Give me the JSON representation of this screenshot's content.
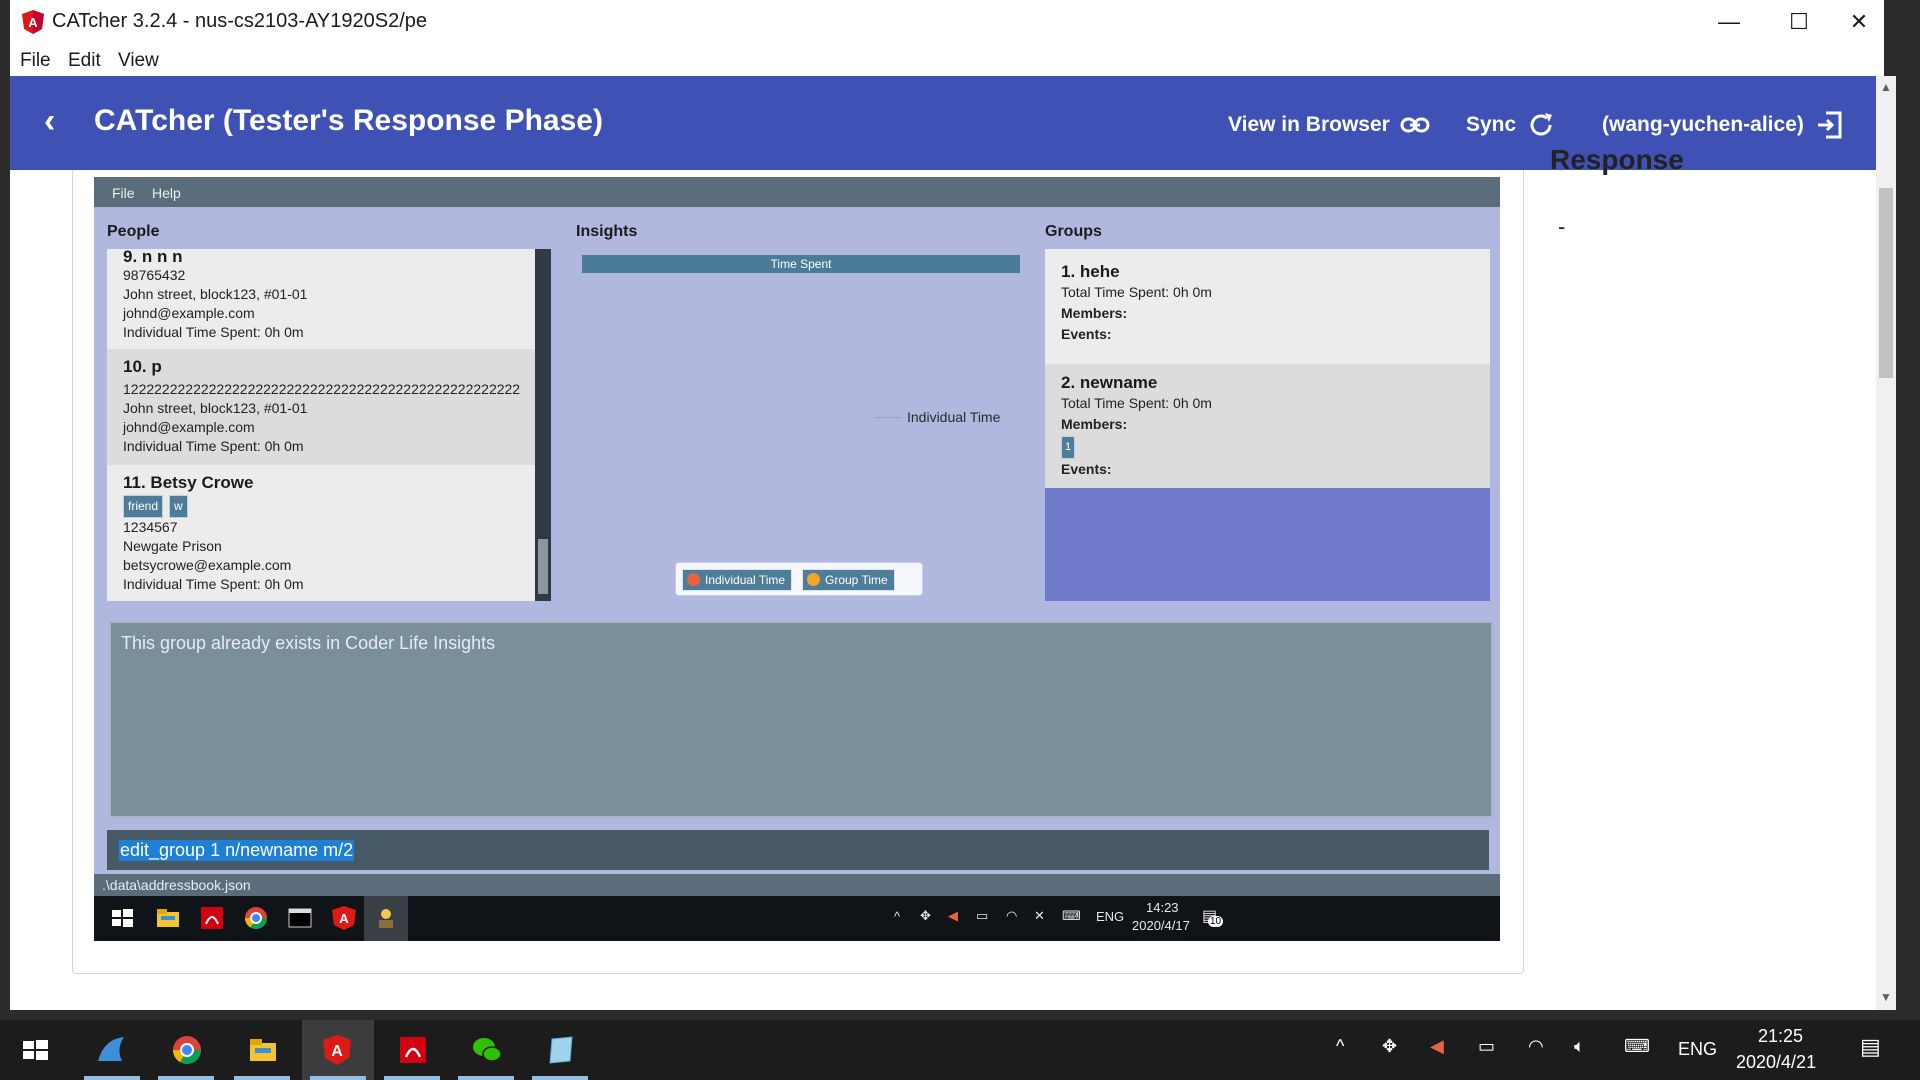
{
  "window": {
    "title": "CATcher 3.2.4 - nus-cs2103-AY1920S2/pe",
    "menu": [
      "File",
      "Edit",
      "View"
    ]
  },
  "header": {
    "title": "CATcher  (Tester's Response Phase)",
    "view_in_browser": "View in Browser",
    "sync": "Sync",
    "user": "(wang-yuchen-alice)"
  },
  "response": {
    "value": "-"
  },
  "app": {
    "menu": [
      "File",
      "Help"
    ],
    "people_title": "People",
    "insights_title": "Insights",
    "groups_title": "Groups",
    "people": [
      {
        "name": "9.  n n n",
        "tags": [],
        "lines": [
          "98765432",
          "John street, block123, #01-01",
          "johnd@example.com",
          "Individual Time Spent: 0h 0m"
        ]
      },
      {
        "name": "10.  p",
        "tags": [],
        "lines": [
          "122222222222222222222222222222222222222222222222222",
          "John street, block123, #01-01",
          "johnd@example.com",
          "Individual Time Spent: 0h 0m"
        ]
      },
      {
        "name": "11.  Betsy Crowe",
        "tags": [
          "friend",
          "w"
        ],
        "lines": [
          "1234567",
          "Newgate Prison",
          "betsycrowe@example.com",
          "Individual Time Spent: 0h 0m"
        ]
      }
    ],
    "chart_title": "Time Spent",
    "chart_label": "Individual Time",
    "legend": [
      "Individual Time",
      "Group Time"
    ],
    "groups": [
      {
        "name": "1.  hehe",
        "time": "Total Time Spent: 0h 0m",
        "members_label": "Members:",
        "members": [],
        "events_label": "Events:"
      },
      {
        "name": "2.  newname",
        "time": "Total Time Spent: 0h 0m",
        "members_label": "Members:",
        "members": [
          "1"
        ],
        "events_label": "Events:"
      }
    ],
    "result": "This group already exists in Coder Life Insights",
    "command": "edit_group 1  n/newname m/2",
    "status_path": ".\\data\\addressbook.json",
    "inner_taskbar": {
      "lang": "ENG",
      "time": "14:23",
      "date": "2020/4/17",
      "notif": "10"
    }
  },
  "taskbar": {
    "lang": "ENG",
    "time": "21:25",
    "date": "2020/4/21"
  },
  "colors": {
    "header": "#3f51b5",
    "groups_bg": "#6f7acb",
    "app_bg": "#b0b8e0"
  }
}
